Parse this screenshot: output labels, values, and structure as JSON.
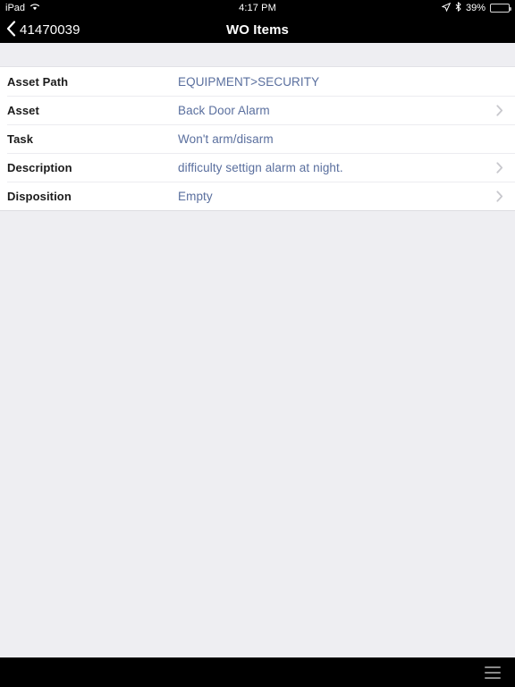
{
  "status_bar": {
    "carrier": "iPad",
    "wifi_icon": "wifi-icon",
    "time": "4:17 PM",
    "location_icon": "location-arrow-icon",
    "bluetooth_icon": "bluetooth-icon",
    "battery_percent_label": "39%",
    "battery_level": 39
  },
  "nav_bar": {
    "back_icon": "chevron-left-icon",
    "back_label": "41470039",
    "title": "WO Items"
  },
  "list": {
    "rows": [
      {
        "label": "Asset Path",
        "value": "EQUIPMENT>SECURITY",
        "has_chevron": false,
        "name": "row-asset-path"
      },
      {
        "label": "Asset",
        "value": "Back Door Alarm",
        "has_chevron": true,
        "name": "row-asset"
      },
      {
        "label": "Task",
        "value": "Won't arm/disarm",
        "has_chevron": false,
        "name": "row-task"
      },
      {
        "label": "Description",
        "value": "difficulty settign alarm at night.",
        "has_chevron": true,
        "name": "row-description"
      },
      {
        "label": "Disposition",
        "value": "Empty",
        "has_chevron": true,
        "name": "row-disposition"
      }
    ]
  },
  "bottom_bar": {
    "menu_icon": "hamburger-menu-icon"
  },
  "colors": {
    "bar_background": "#000000",
    "page_background": "#eeeef2",
    "row_background": "#ffffff",
    "label_text": "#1b1b1b",
    "value_text": "#5a6f9e",
    "separator": "#ececf0",
    "chevron": "#c8c8cd",
    "menu_icon": "#8a8a8a"
  }
}
